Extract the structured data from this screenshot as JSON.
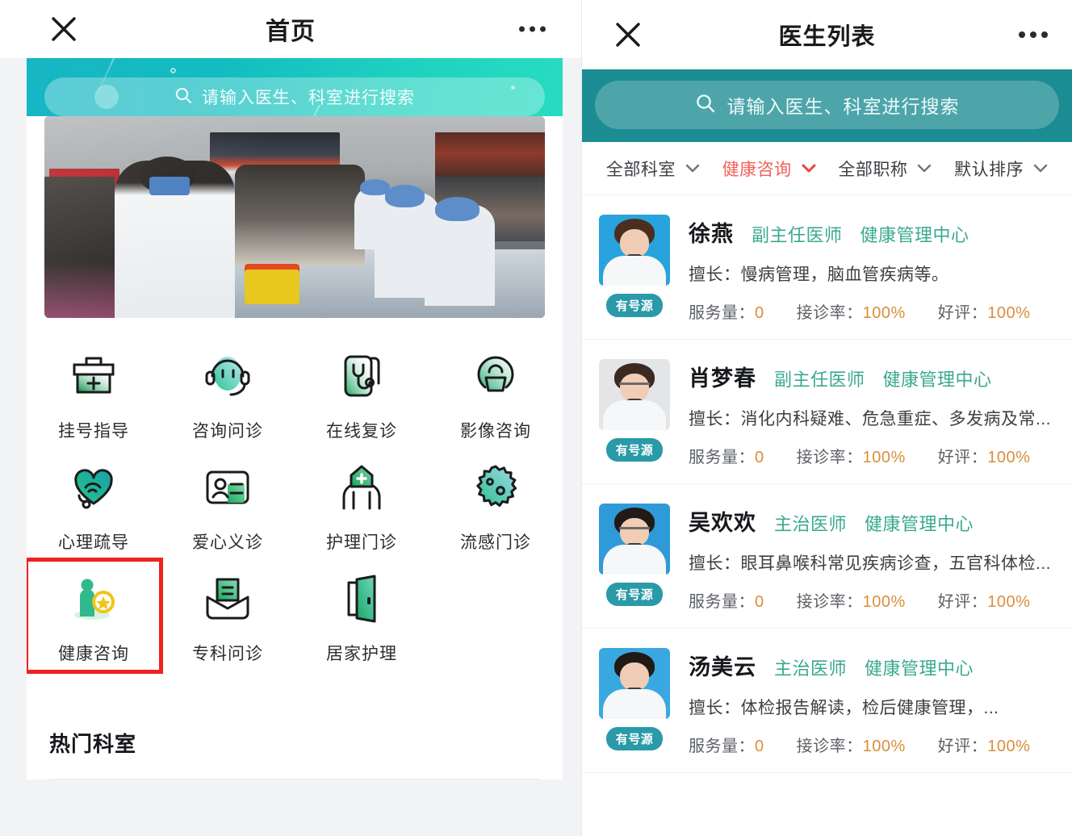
{
  "left": {
    "nav": {
      "title": "首页",
      "close_icon": "close-icon",
      "more_icon": "more-dots-icon"
    },
    "search": {
      "placeholder": "请输入医生、科室进行搜索",
      "icon": "search-icon"
    },
    "banner_image_alt": "医院义诊采血现场照片",
    "services": [
      {
        "label": "挂号指导",
        "icon": "medical-kit-icon",
        "highlighted": false
      },
      {
        "label": "咨询问诊",
        "icon": "headset-icon",
        "highlighted": false
      },
      {
        "label": "在线复诊",
        "icon": "stethoscope-phone-icon",
        "highlighted": false
      },
      {
        "label": "影像咨询",
        "icon": "imaging-scanner-icon",
        "highlighted": false
      },
      {
        "label": "心理疏导",
        "icon": "heart-wifi-icon",
        "highlighted": false
      },
      {
        "label": "爱心义诊",
        "icon": "id-card-icon",
        "highlighted": false
      },
      {
        "label": "护理门诊",
        "icon": "hands-house-cross-icon",
        "highlighted": false
      },
      {
        "label": "流感门诊",
        "icon": "virus-icon",
        "highlighted": false
      },
      {
        "label": "健康咨询",
        "icon": "person-plus-icon",
        "highlighted": true
      },
      {
        "label": "专科问诊",
        "icon": "envelope-letter-icon",
        "highlighted": false
      },
      {
        "label": "居家护理",
        "icon": "door-icon",
        "highlighted": false
      }
    ],
    "hot_section": {
      "title": "热门科室"
    },
    "colors": {
      "banner_gradient_start": "#17b6c4",
      "banner_gradient_end": "#28dcc2",
      "highlight_box": "#ef2121"
    }
  },
  "right": {
    "nav": {
      "title": "医生列表",
      "close_icon": "close-icon",
      "more_icon": "more-dots-icon"
    },
    "search": {
      "placeholder": "请输入医生、科室进行搜索",
      "icon": "search-icon",
      "band_color": "#1c8c93"
    },
    "filters": [
      {
        "label": "全部科室",
        "active": false,
        "icon": "chevron-down-icon"
      },
      {
        "label": "健康咨询",
        "active": true,
        "icon": "chevron-down-icon"
      },
      {
        "label": "全部职称",
        "active": false,
        "icon": "chevron-down-icon"
      },
      {
        "label": "默认排序",
        "active": false,
        "icon": "chevron-down-icon"
      }
    ],
    "stat_labels": {
      "service": "服务量",
      "accept": "接诊率",
      "praise": "好评"
    },
    "doctors": [
      {
        "name": "徐燕",
        "title": "副主任医师",
        "dept": "健康管理中心",
        "specialty": "擅长：慢病管理，脑血管疾病等。",
        "badge": "有号源",
        "service_volume": "0",
        "accept_rate": "100%",
        "praise_rate": "100%",
        "avatar_bg": "#29a3dd",
        "avatar_hair": "#4a2f21"
      },
      {
        "name": "肖梦春",
        "title": "副主任医师",
        "dept": "健康管理中心",
        "specialty": "擅长：消化内科疑难、危急重症、多发病及常...",
        "badge": "有号源",
        "service_volume": "0",
        "accept_rate": "100%",
        "praise_rate": "100%",
        "avatar_bg": "#e3e5e7",
        "avatar_hair": "#3a2a22"
      },
      {
        "name": "吴欢欢",
        "title": "主治医师",
        "dept": "健康管理中心",
        "specialty": "擅长：眼耳鼻喉科常见疾病诊查，五官科体检...",
        "badge": "有号源",
        "service_volume": "0",
        "accept_rate": "100%",
        "praise_rate": "100%",
        "avatar_bg": "#2f9ad8",
        "avatar_hair": "#221a16"
      },
      {
        "name": "汤美云",
        "title": "主治医师",
        "dept": "健康管理中心",
        "specialty": "擅长：体检报告解读，检后健康管理，...",
        "badge": "有号源",
        "service_volume": "0",
        "accept_rate": "100%",
        "praise_rate": "100%",
        "avatar_bg": "#3aa8e0",
        "avatar_hair": "#201a17"
      }
    ],
    "colors": {
      "doctor_title": "#3aa98f",
      "stat_value": "#d88f3a",
      "badge_bg": "#2a9aa8",
      "active_filter": "#f2605a"
    }
  }
}
